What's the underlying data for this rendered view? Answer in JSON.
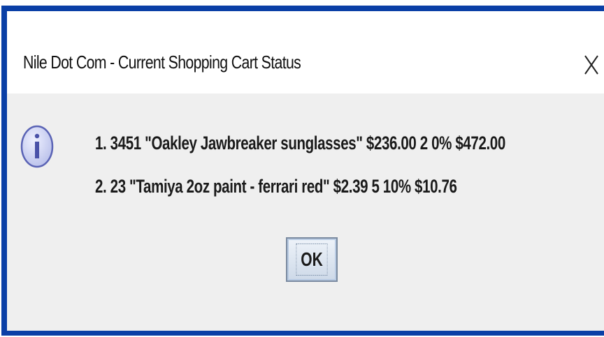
{
  "dialog": {
    "title": "Nile Dot Com - Current Shopping Cart Status",
    "icon": "info-icon",
    "close_icon": "close-icon",
    "messages": [
      "1. 3451 \"Oakley Jawbreaker sunglasses\" $236.00 2 0% $472.00",
      "2. 23 \"Tamiya 2oz paint - ferrari red\" $2.39 5 10% $10.76"
    ],
    "ok_label": "OK"
  },
  "colors": {
    "frame": "#0a3fa6",
    "title_bar": "#ffffff",
    "content_bg": "#efefef",
    "icon_fill": "#c9cff0",
    "icon_stroke": "#5a63b5"
  }
}
